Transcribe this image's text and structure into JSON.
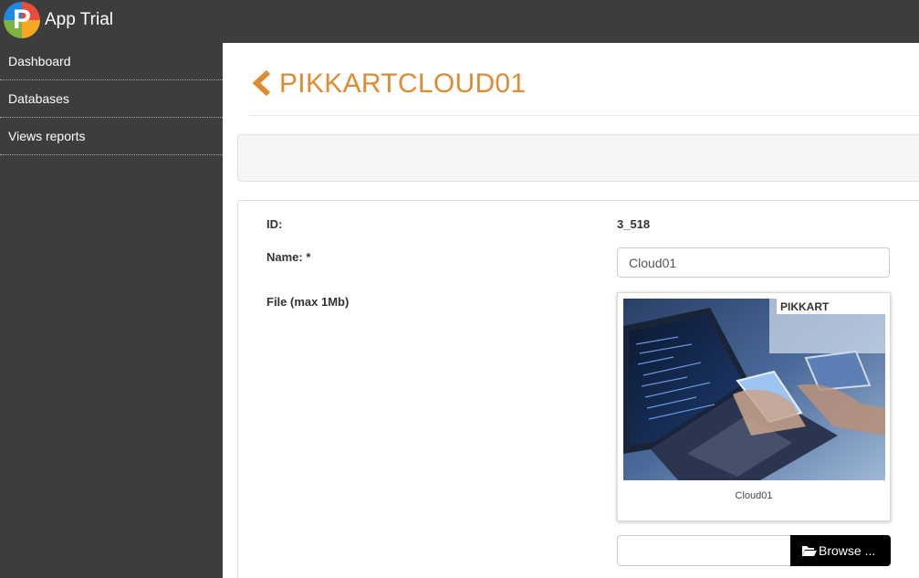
{
  "app": {
    "title": "App Trial",
    "logo_letter": "P"
  },
  "sidebar": {
    "items": [
      {
        "label": "Dashboard"
      },
      {
        "label": "Databases"
      },
      {
        "label": "Views reports"
      }
    ]
  },
  "header": {
    "title": "PIKKARTCLOUD01",
    "accent_color": "#e08a31"
  },
  "form": {
    "id_label": "ID:",
    "id_value": "3_518",
    "name_label": "Name: *",
    "name_value": "Cloud01",
    "file_label": "File (max 1Mb)",
    "image_caption": "Cloud01",
    "browse_label": "Browse ..."
  },
  "image": {
    "brand_text": "PIKKART"
  }
}
